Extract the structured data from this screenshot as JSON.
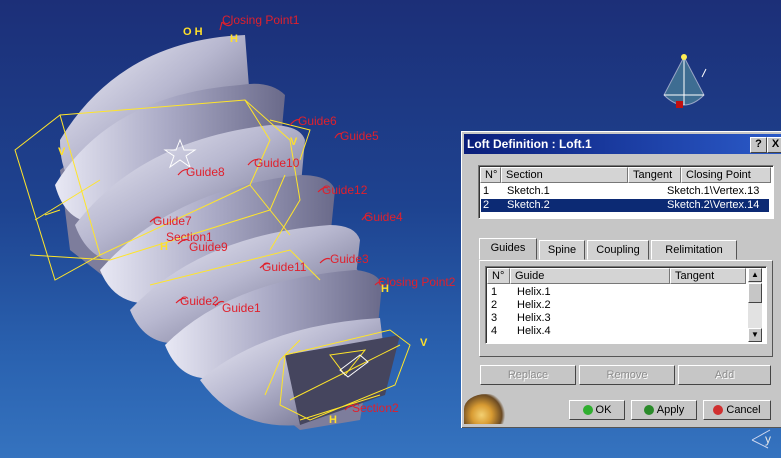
{
  "viewport": {
    "guide_labels": [
      "Guide6",
      "Guide5",
      "Guide8",
      "Guide10",
      "Guide12",
      "Guide4",
      "Guide7",
      "Guide9",
      "Guide11",
      "Guide3",
      "Guide2",
      "Guide1"
    ],
    "section_labels": [
      "Section1",
      "Section2"
    ],
    "closing_labels": [
      "Closing Point1",
      "Closing Point2"
    ],
    "marker_h": "H",
    "marker_v": "V",
    "marker_oh": "O H",
    "compass_axis": "y"
  },
  "dialog": {
    "title": "Loft Definition : Loft.1",
    "help_button": "?",
    "close_button": "X",
    "sections_table": {
      "headers": [
        "N°",
        "Section",
        "Tangent",
        "Closing Point"
      ],
      "rows": [
        {
          "n": "1",
          "section": "Sketch.1",
          "tangent": "",
          "closing": "Sketch.1\\Vertex.13",
          "selected": false
        },
        {
          "n": "2",
          "section": "Sketch.2",
          "tangent": "",
          "closing": "Sketch.2\\Vertex.14",
          "selected": true
        }
      ]
    },
    "tabs": [
      "Guides",
      "Spine",
      "Coupling",
      "Relimitation"
    ],
    "active_tab": "Guides",
    "guides_table": {
      "headers": [
        "N°",
        "Guide",
        "Tangent"
      ],
      "rows": [
        {
          "n": "1",
          "guide": "Helix.1",
          "tangent": ""
        },
        {
          "n": "2",
          "guide": "Helix.2",
          "tangent": ""
        },
        {
          "n": "3",
          "guide": "Helix.3",
          "tangent": ""
        },
        {
          "n": "4",
          "guide": "Helix.4",
          "tangent": ""
        }
      ]
    },
    "actions": {
      "replace": "Replace",
      "remove": "Remove",
      "add": "Add"
    },
    "buttons": {
      "ok": "OK",
      "apply": "Apply",
      "cancel": "Cancel"
    },
    "colors": {
      "title_start": "#0a1e7a",
      "title_end": "#2b5ac8",
      "selection": "#0c2a74",
      "ok_icon": "#2fae2f",
      "apply_icon": "#2a8a2a",
      "cancel_icon": "#d03030"
    }
  }
}
